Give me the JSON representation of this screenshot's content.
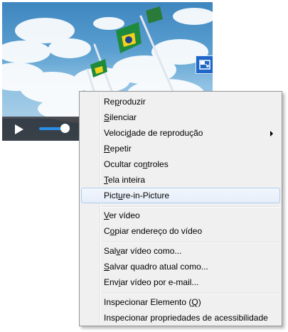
{
  "video": {
    "pip_icon": "picture-in-picture-icon",
    "controls": {
      "play_icon": "play-icon",
      "volume_level": 0.75
    }
  },
  "context_menu": {
    "items": [
      {
        "label": "Reproduzir",
        "access_key": "p"
      },
      {
        "label": "Silenciar",
        "access_key": "S"
      },
      {
        "label": "Velocidade de reprodução",
        "access_key": "d",
        "submenu": true
      },
      {
        "label": "Repetir",
        "access_key": "R"
      },
      {
        "label": "Ocultar controles",
        "access_key": "n"
      },
      {
        "label": "Tela inteira",
        "access_key": "T"
      },
      {
        "label": "Picture-in-Picture",
        "access_key": "u",
        "highlighted": true
      },
      {
        "label": "Ver vídeo",
        "access_key": "V"
      },
      {
        "label": "Copiar endereço do vídeo",
        "access_key": "o"
      },
      {
        "label": "Salvar vídeo como...",
        "access_key": "v"
      },
      {
        "label": "Salvar quadro atual como...",
        "access_key": "S"
      },
      {
        "label": "Enviar vídeo por e-mail...",
        "access_key": "i"
      },
      {
        "label": "Inspecionar Elemento (Q)",
        "access_key": "Q"
      },
      {
        "label": "Inspecionar propriedades de acessibilidade",
        "access_key": ""
      }
    ]
  }
}
